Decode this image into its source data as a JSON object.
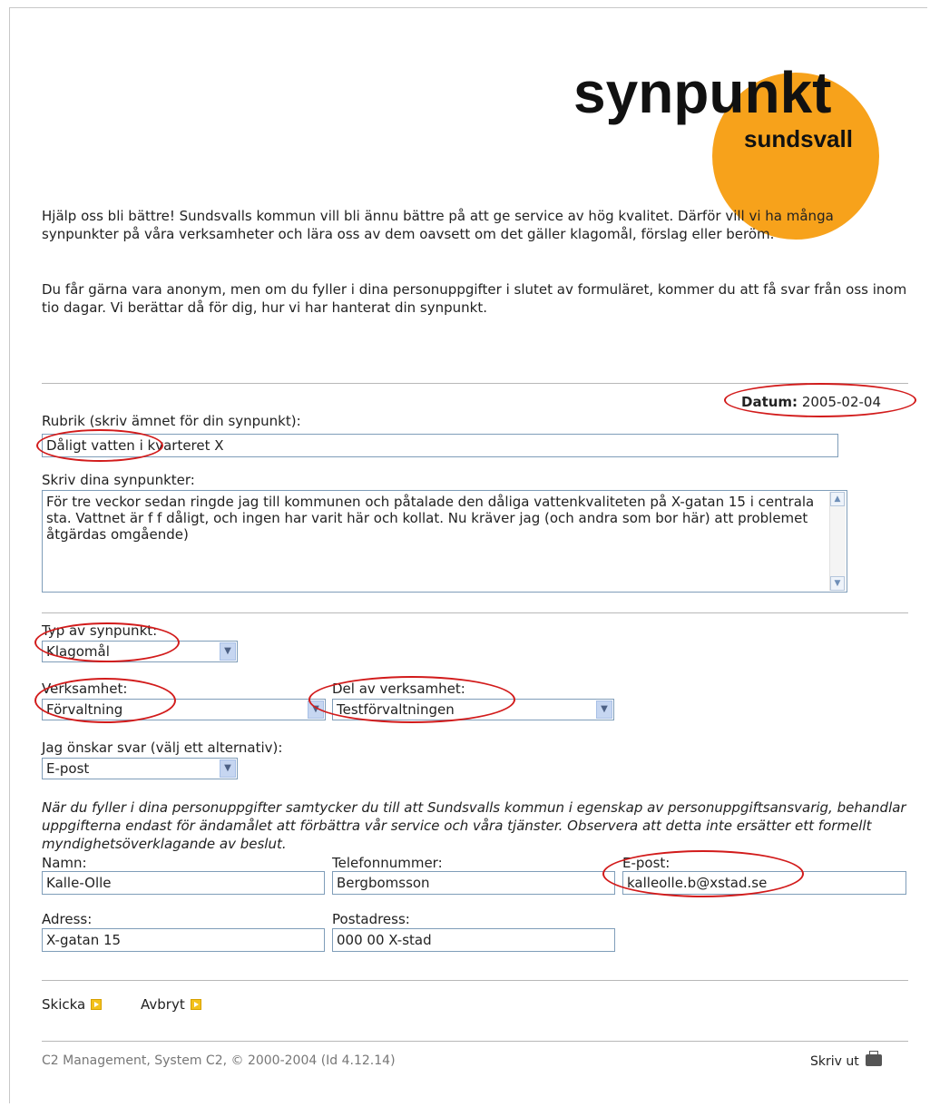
{
  "logo": {
    "main": "synpunkt",
    "sub": "sundsvall",
    "circle_color": "#f7a21b"
  },
  "intro": {
    "p1": "Hjälp oss bli bättre! Sundsvalls kommun vill bli ännu bättre på att ge service av hög kvalitet. Därför vill vi ha många synpunkter på våra verksamheter och lära oss av dem oavsett om det gäller klagomål, förslag eller beröm.",
    "p2": "Du får gärna vara anonym, men om du fyller i dina personuppgifter i slutet av formuläret, kommer du att få svar från oss inom tio dagar. Vi berättar då för dig, hur vi har hanterat din synpunkt."
  },
  "date": {
    "label": "Datum:",
    "value": "2005-02-04"
  },
  "subject": {
    "label": "Rubrik (skriv ämnet för din synpunkt):",
    "value": "Dåligt vatten i kvarteret X"
  },
  "comments": {
    "label": "Skriv dina synpunkter:",
    "value": "För tre veckor sedan ringde jag till kommunen och påtalade den dåliga vattenkvaliteten på X-gatan 15 i centrala sta. Vattnet är f f dåligt, och ingen har varit här och kollat. Nu kräver jag (och andra som bor här) att problemet åtgärdas omgående)"
  },
  "type": {
    "label": "Typ av synpunkt:",
    "value": "Klagomål"
  },
  "department": {
    "label": "Verksamhet:",
    "value": "Förvaltning"
  },
  "sub_department": {
    "label": "Del av verksamhet:",
    "value": "Testförvaltningen"
  },
  "reply": {
    "label": "Jag önskar svar (välj ett alternativ):",
    "value": "E-post"
  },
  "consent": "När du fyller i dina personuppgifter samtycker du till att Sundsvalls kommun i egenskap av personuppgiftsansvarig, behandlar uppgifterna endast för ändamålet att förbättra vår service och våra tjänster. Observera att detta inte ersätter ett formellt myndighetsöverklagande av beslut.",
  "name": {
    "label": "Namn:",
    "value": "Kalle-Olle"
  },
  "phone": {
    "label": "Telefonnummer:",
    "value": "Bergbomsson"
  },
  "email": {
    "label": "E-post:",
    "value": "kalleolle.b@xstad.se"
  },
  "address": {
    "label": "Adress:",
    "value": "X-gatan 15"
  },
  "postal": {
    "label": "Postadress:",
    "value": "000 00 X-stad"
  },
  "actions": {
    "send": "Skicka",
    "cancel": "Avbryt"
  },
  "footer": {
    "copyright": "C2 Management, System C2, © 2000-2004 (Id 4.12.14)",
    "print": "Skriv ut"
  },
  "colors": {
    "annotation": "#d21b1b",
    "input_border": "#7f9db9"
  }
}
